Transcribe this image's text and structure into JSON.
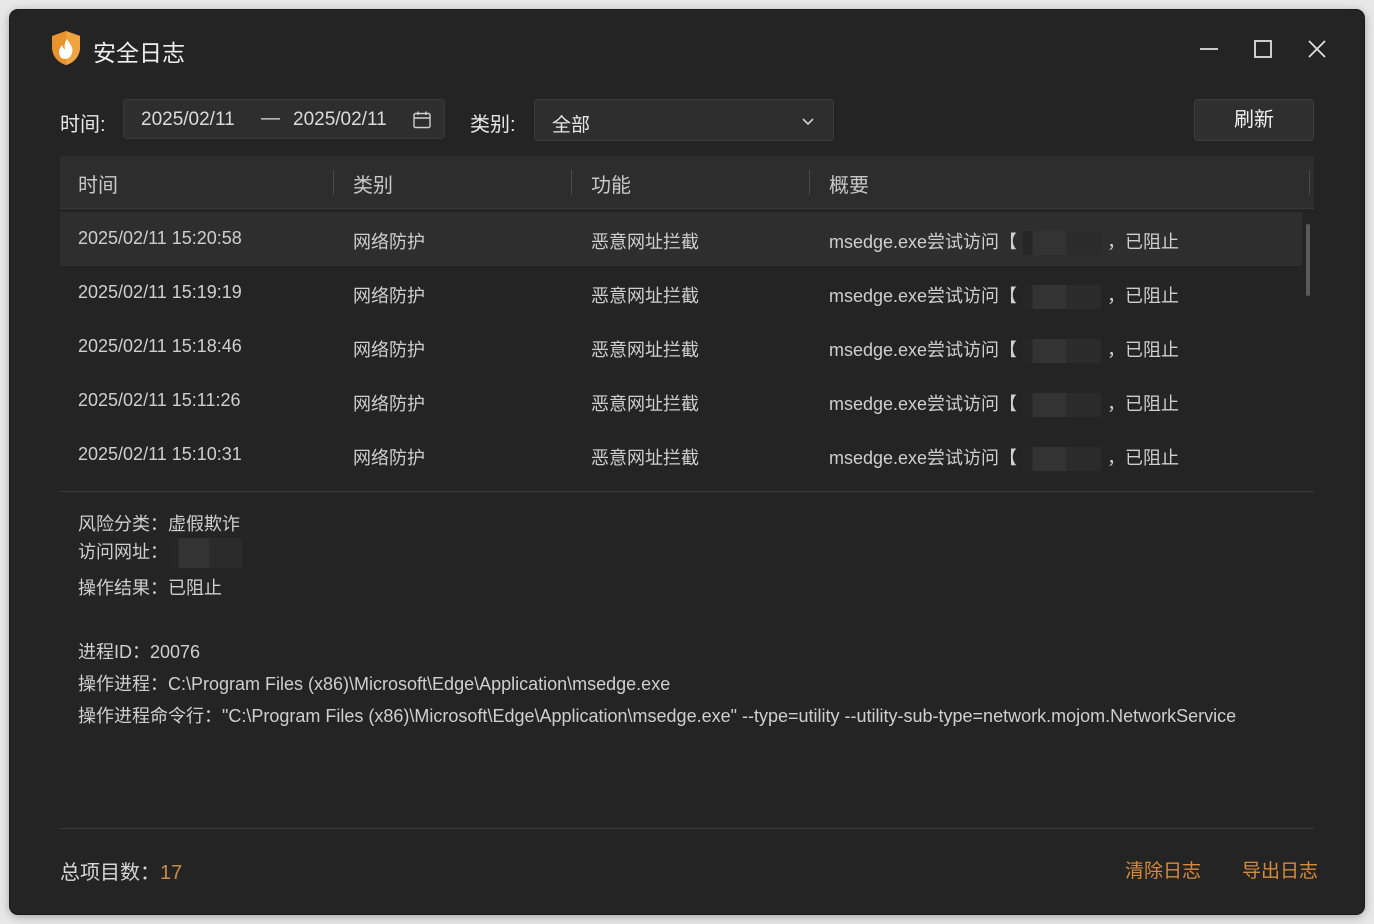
{
  "window": {
    "title": "安全日志",
    "controls": [
      "minimize-icon",
      "maximize-icon",
      "close-icon"
    ]
  },
  "filters": {
    "time_label": "时间:",
    "date_start": "2025/02/11",
    "date_sep": "—",
    "date_end": "2025/02/11",
    "category_label": "类别:",
    "category_value": "全部",
    "refresh_label": "刷新"
  },
  "table": {
    "columns": [
      "时间",
      "类别",
      "功能",
      "概要"
    ],
    "rows": [
      {
        "time": "2025/02/11 15:20:58",
        "category": "网络防护",
        "function": "恶意网址拦截",
        "summary_prefix": "msedge.exe尝试访问【",
        "summary_suffix": "，已阻止"
      },
      {
        "time": "2025/02/11 15:19:19",
        "category": "网络防护",
        "function": "恶意网址拦截",
        "summary_prefix": "msedge.exe尝试访问【",
        "summary_suffix": "，已阻止"
      },
      {
        "time": "2025/02/11 15:18:46",
        "category": "网络防护",
        "function": "恶意网址拦截",
        "summary_prefix": "msedge.exe尝试访问【",
        "summary_suffix": "，已阻止"
      },
      {
        "time": "2025/02/11 15:11:26",
        "category": "网络防护",
        "function": "恶意网址拦截",
        "summary_prefix": "msedge.exe尝试访问【",
        "summary_suffix": "，已阻止"
      },
      {
        "time": "2025/02/11 15:10:31",
        "category": "网络防护",
        "function": "恶意网址拦截",
        "summary_prefix": "msedge.exe尝试访问【",
        "summary_suffix": "，已阻止"
      }
    ]
  },
  "detail": {
    "risk": "风险分类：虚假欺诈",
    "url_label": "访问网址：",
    "result": "操作结果：已阻止",
    "pid": "进程ID：20076",
    "process": "操作进程：C:\\Program Files (x86)\\Microsoft\\Edge\\Application\\msedge.exe",
    "cmdline": "操作进程命令行：\"C:\\Program Files (x86)\\Microsoft\\Edge\\Application\\msedge.exe\" --type=utility --utility-sub-type=network.mojom.NetworkService"
  },
  "footer": {
    "total_label": "总项目数：",
    "total_value": "17",
    "clear_label": "清除日志",
    "export_label": "导出日志"
  },
  "colors": {
    "accent": "#d68b3c",
    "background": "#242424"
  }
}
